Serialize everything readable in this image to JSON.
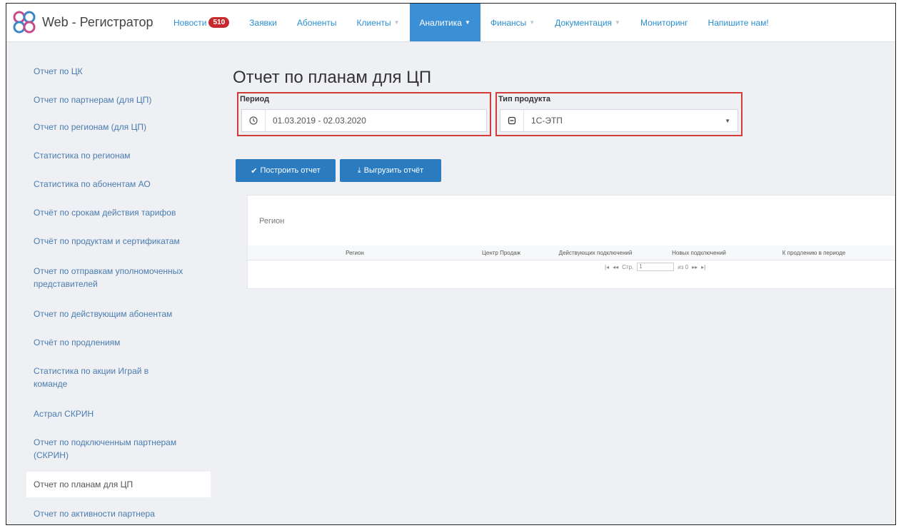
{
  "header": {
    "brand": "Web - Регистратор",
    "nav": [
      {
        "label": "Новости",
        "badge": "510"
      },
      {
        "label": "Заявки"
      },
      {
        "label": "Абоненты"
      },
      {
        "label": "Клиенты"
      },
      {
        "label": "Аналитика"
      },
      {
        "label": "Финансы"
      },
      {
        "label": "Документация"
      },
      {
        "label": "Мониторинг"
      },
      {
        "label": "Напишите нам!"
      }
    ]
  },
  "sidebar": {
    "items": [
      "Отчет по ЦК",
      "Отчет по партнерам (для ЦП)",
      "Отчет по регионам (для ЦП)",
      "Статистика по регионам",
      "Статистика по абонентам АО",
      "Отчёт по срокам действия тарифов",
      "Отчёт по продуктам и сертификатам",
      "Отчет по отправкам уполномоченных представителей",
      "Отчет по действующим абонентам",
      "Отчёт по продлениям",
      "Статистика по акции Играй в команде",
      "Астрал СКРИН",
      "Отчет по подключенным партнерам (СКРИН)",
      "Отчет по планам для ЦП",
      "Отчет по активности партнера"
    ],
    "active_index": 13
  },
  "main": {
    "title": "Отчет по планам для ЦП",
    "period": {
      "label": "Период",
      "value": "01.03.2019 - 02.03.2020"
    },
    "product": {
      "label": "Тип продукта",
      "value": "1С-ЭТП"
    },
    "build_button": "Построить отчет",
    "export_button": "Выгрузить отчёт",
    "region_label": "Регион",
    "table": {
      "columns": [
        "Регион",
        "Центр Продаж",
        "Действующих подключений",
        "Новых подключений",
        "К продлению в периоде"
      ]
    },
    "pager": {
      "page_label": "Стр.",
      "page": "1",
      "of": "из 0"
    }
  },
  "colors": {
    "accent": "#3b8fd4",
    "link": "#2a8fd0",
    "badge": "#c7292c",
    "highlight": "#d33b3b",
    "button": "#2a7bbf"
  }
}
